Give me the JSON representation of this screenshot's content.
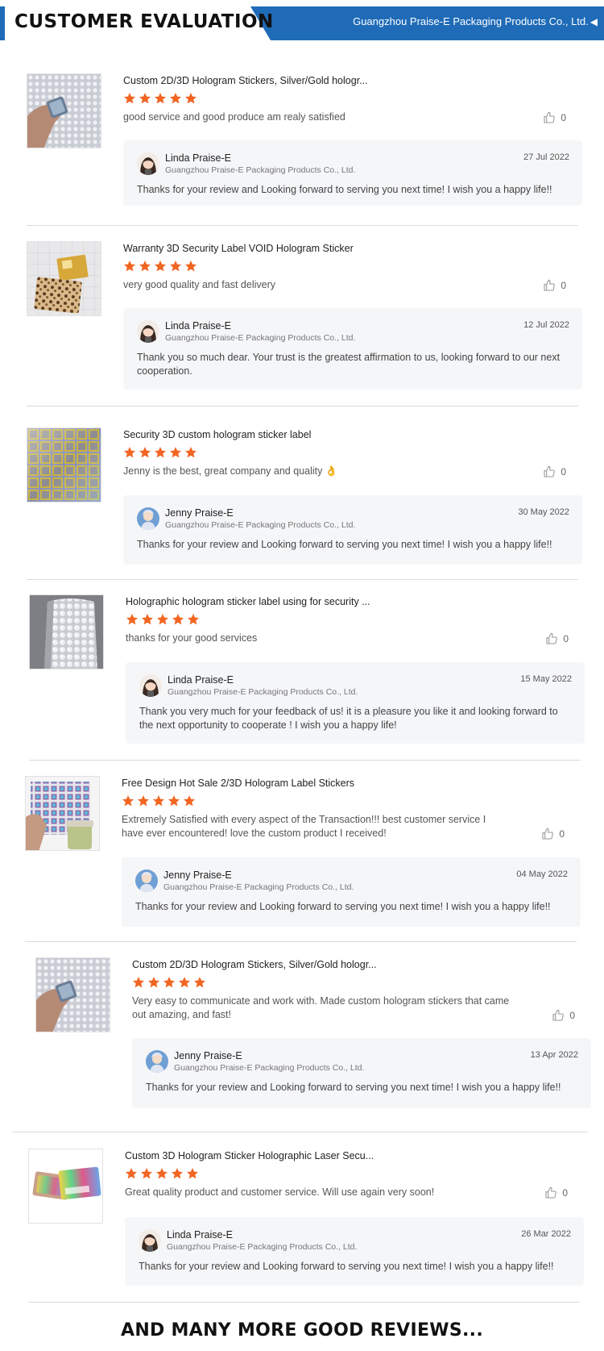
{
  "header": {
    "title": "CUSTOMER EVALUATION",
    "company": "Guangzhou Praise-E Packaging Products Co., Ltd.",
    "arrow": "◀"
  },
  "colors": {
    "banner_blue": "#1f6bb7",
    "star_orange": "#f26522",
    "reply_bg": "#f5f6f8"
  },
  "reviews": [
    {
      "product_title": "Custom 2D/3D Hologram Stickers, Silver/Gold hologr...",
      "stars": 5,
      "text": "good service and good produce am realy satisfied",
      "likes": "0",
      "reply": {
        "name": "Linda Praise-E",
        "company": "Guangzhou Praise-E Packaging Products Co., Ltd.",
        "date": "27 Jul 2022",
        "text": "Thanks for your review and Looking forward to serving you next time! I wish you a happy life!!"
      }
    },
    {
      "product_title": "Warranty 3D Security Label VOID Hologram Sticker",
      "stars": 5,
      "text": "very good quality and fast delivery",
      "likes": "0",
      "reply": {
        "name": "Linda Praise-E",
        "company": "Guangzhou Praise-E Packaging Products Co., Ltd.",
        "date": "12 Jul 2022",
        "text": "Thank you so much dear. Your trust is the greatest affirmation to us, looking forward to our next cooperation."
      }
    },
    {
      "product_title": "Security 3D custom hologram sticker label",
      "stars": 5,
      "text": "Jenny is the best, great company and quality 👌",
      "likes": "0",
      "reply": {
        "name": "Jenny Praise-E",
        "company": "Guangzhou Praise-E Packaging Products Co., Ltd.",
        "date": "30 May 2022",
        "text": "Thanks for your review and Looking forward to serving you next time! I wish you a happy life!!"
      }
    },
    {
      "product_title": "Holographic hologram sticker label using for security ...",
      "stars": 5,
      "text": "thanks for your good services",
      "likes": "0",
      "reply": {
        "name": "Linda Praise-E",
        "company": "Guangzhou Praise-E Packaging Products Co., Ltd.",
        "date": "15 May 2022",
        "text": "Thank you very much for your feedback of us!   it is a pleasure you like it and looking forward to the next opportunity to cooperate ! I wish you a happy life!"
      }
    },
    {
      "product_title": "Free Design Hot Sale 2/3D Hologram Label Stickers",
      "stars": 5,
      "text": "Extremely Satisfied with every aspect of the Transaction!!! best customer service I have ever encountered! love the custom product I received!",
      "likes": "0",
      "reply": {
        "name": "Jenny Praise-E",
        "company": "Guangzhou Praise-E Packaging Products Co., Ltd.",
        "date": "04 May 2022",
        "text": "Thanks for your review and Looking forward to serving you next time!  I wish you a happy life!!"
      }
    },
    {
      "product_title": "Custom 2D/3D Hologram Stickers, Silver/Gold hologr...",
      "stars": 5,
      "text": "Very easy to communicate and work with. Made custom hologram stickers that came out amazing, and fast!",
      "likes": "0",
      "reply": {
        "name": "Jenny Praise-E",
        "company": "Guangzhou Praise-E Packaging Products Co., Ltd.",
        "date": "13 Apr 2022",
        "text": "Thanks for your review and Looking forward to serving you next time!  I wish you a happy life!!"
      }
    },
    {
      "product_title": "Custom 3D Hologram Sticker Holographic Laser Secu...",
      "stars": 5,
      "text": "Great quality product and customer service. Will use again very soon!",
      "likes": "0",
      "reply": {
        "name": "Linda Praise-E",
        "company": "Guangzhou Praise-E Packaging Products Co., Ltd.",
        "date": "26 Mar 2022",
        "text": "Thanks for your review and Looking forward to serving you next time!  I wish you a happy life!!"
      }
    }
  ],
  "footer": {
    "text": "AND MANY MORE GOOD REVIEWS..."
  }
}
